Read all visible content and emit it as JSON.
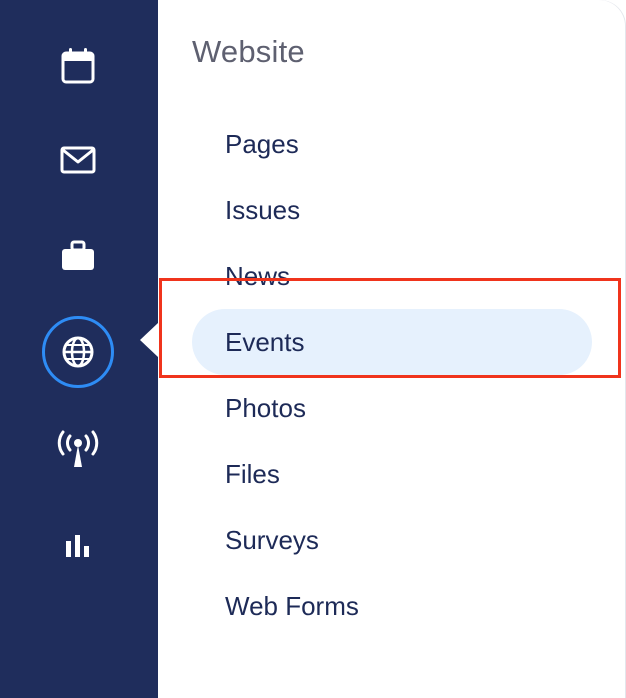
{
  "sidebar": {
    "icons": [
      {
        "name": "calendar-icon",
        "active": false
      },
      {
        "name": "mail-icon",
        "active": false
      },
      {
        "name": "briefcase-icon",
        "active": false
      },
      {
        "name": "globe-icon",
        "active": true
      },
      {
        "name": "broadcast-icon",
        "active": false
      },
      {
        "name": "bar-chart-icon",
        "active": false
      }
    ]
  },
  "panel": {
    "title": "Website",
    "items": [
      {
        "label": "Pages",
        "active": false
      },
      {
        "label": "Issues",
        "active": false
      },
      {
        "label": "News",
        "active": false
      },
      {
        "label": "Events",
        "active": true
      },
      {
        "label": "Photos",
        "active": false
      },
      {
        "label": "Files",
        "active": false
      },
      {
        "label": "Surveys",
        "active": false
      },
      {
        "label": "Web Forms",
        "active": false
      }
    ]
  },
  "colors": {
    "rail_background": "#1f2d5c",
    "active_ring": "#2e8cf5",
    "active_item_background": "#e6f1fd",
    "menu_text": "#1d2a57",
    "highlight_border": "#f0341c"
  }
}
